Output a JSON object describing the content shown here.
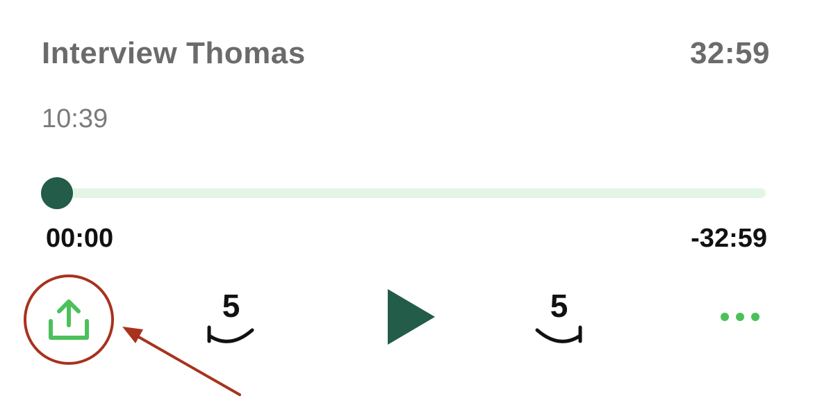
{
  "recording": {
    "title": "Interview Thomas",
    "duration": "32:59",
    "recorded_time": "10:39"
  },
  "playback": {
    "elapsed": "00:00",
    "remaining": "-32:59",
    "progress_fraction": 0
  },
  "controls": {
    "share_icon": "share-upload-icon",
    "skip_back_icon": "skip-back-arc-icon",
    "skip_back_seconds": "5",
    "play_icon": "play-icon",
    "skip_forward_icon": "skip-forward-arc-icon",
    "skip_forward_seconds": "5",
    "more_icon": "more-dots-icon"
  },
  "colors": {
    "accent_green": "#4cc05a",
    "dark_green": "#235c48",
    "track_light": "#e3f6e6",
    "annotation_red": "#a8321e"
  }
}
